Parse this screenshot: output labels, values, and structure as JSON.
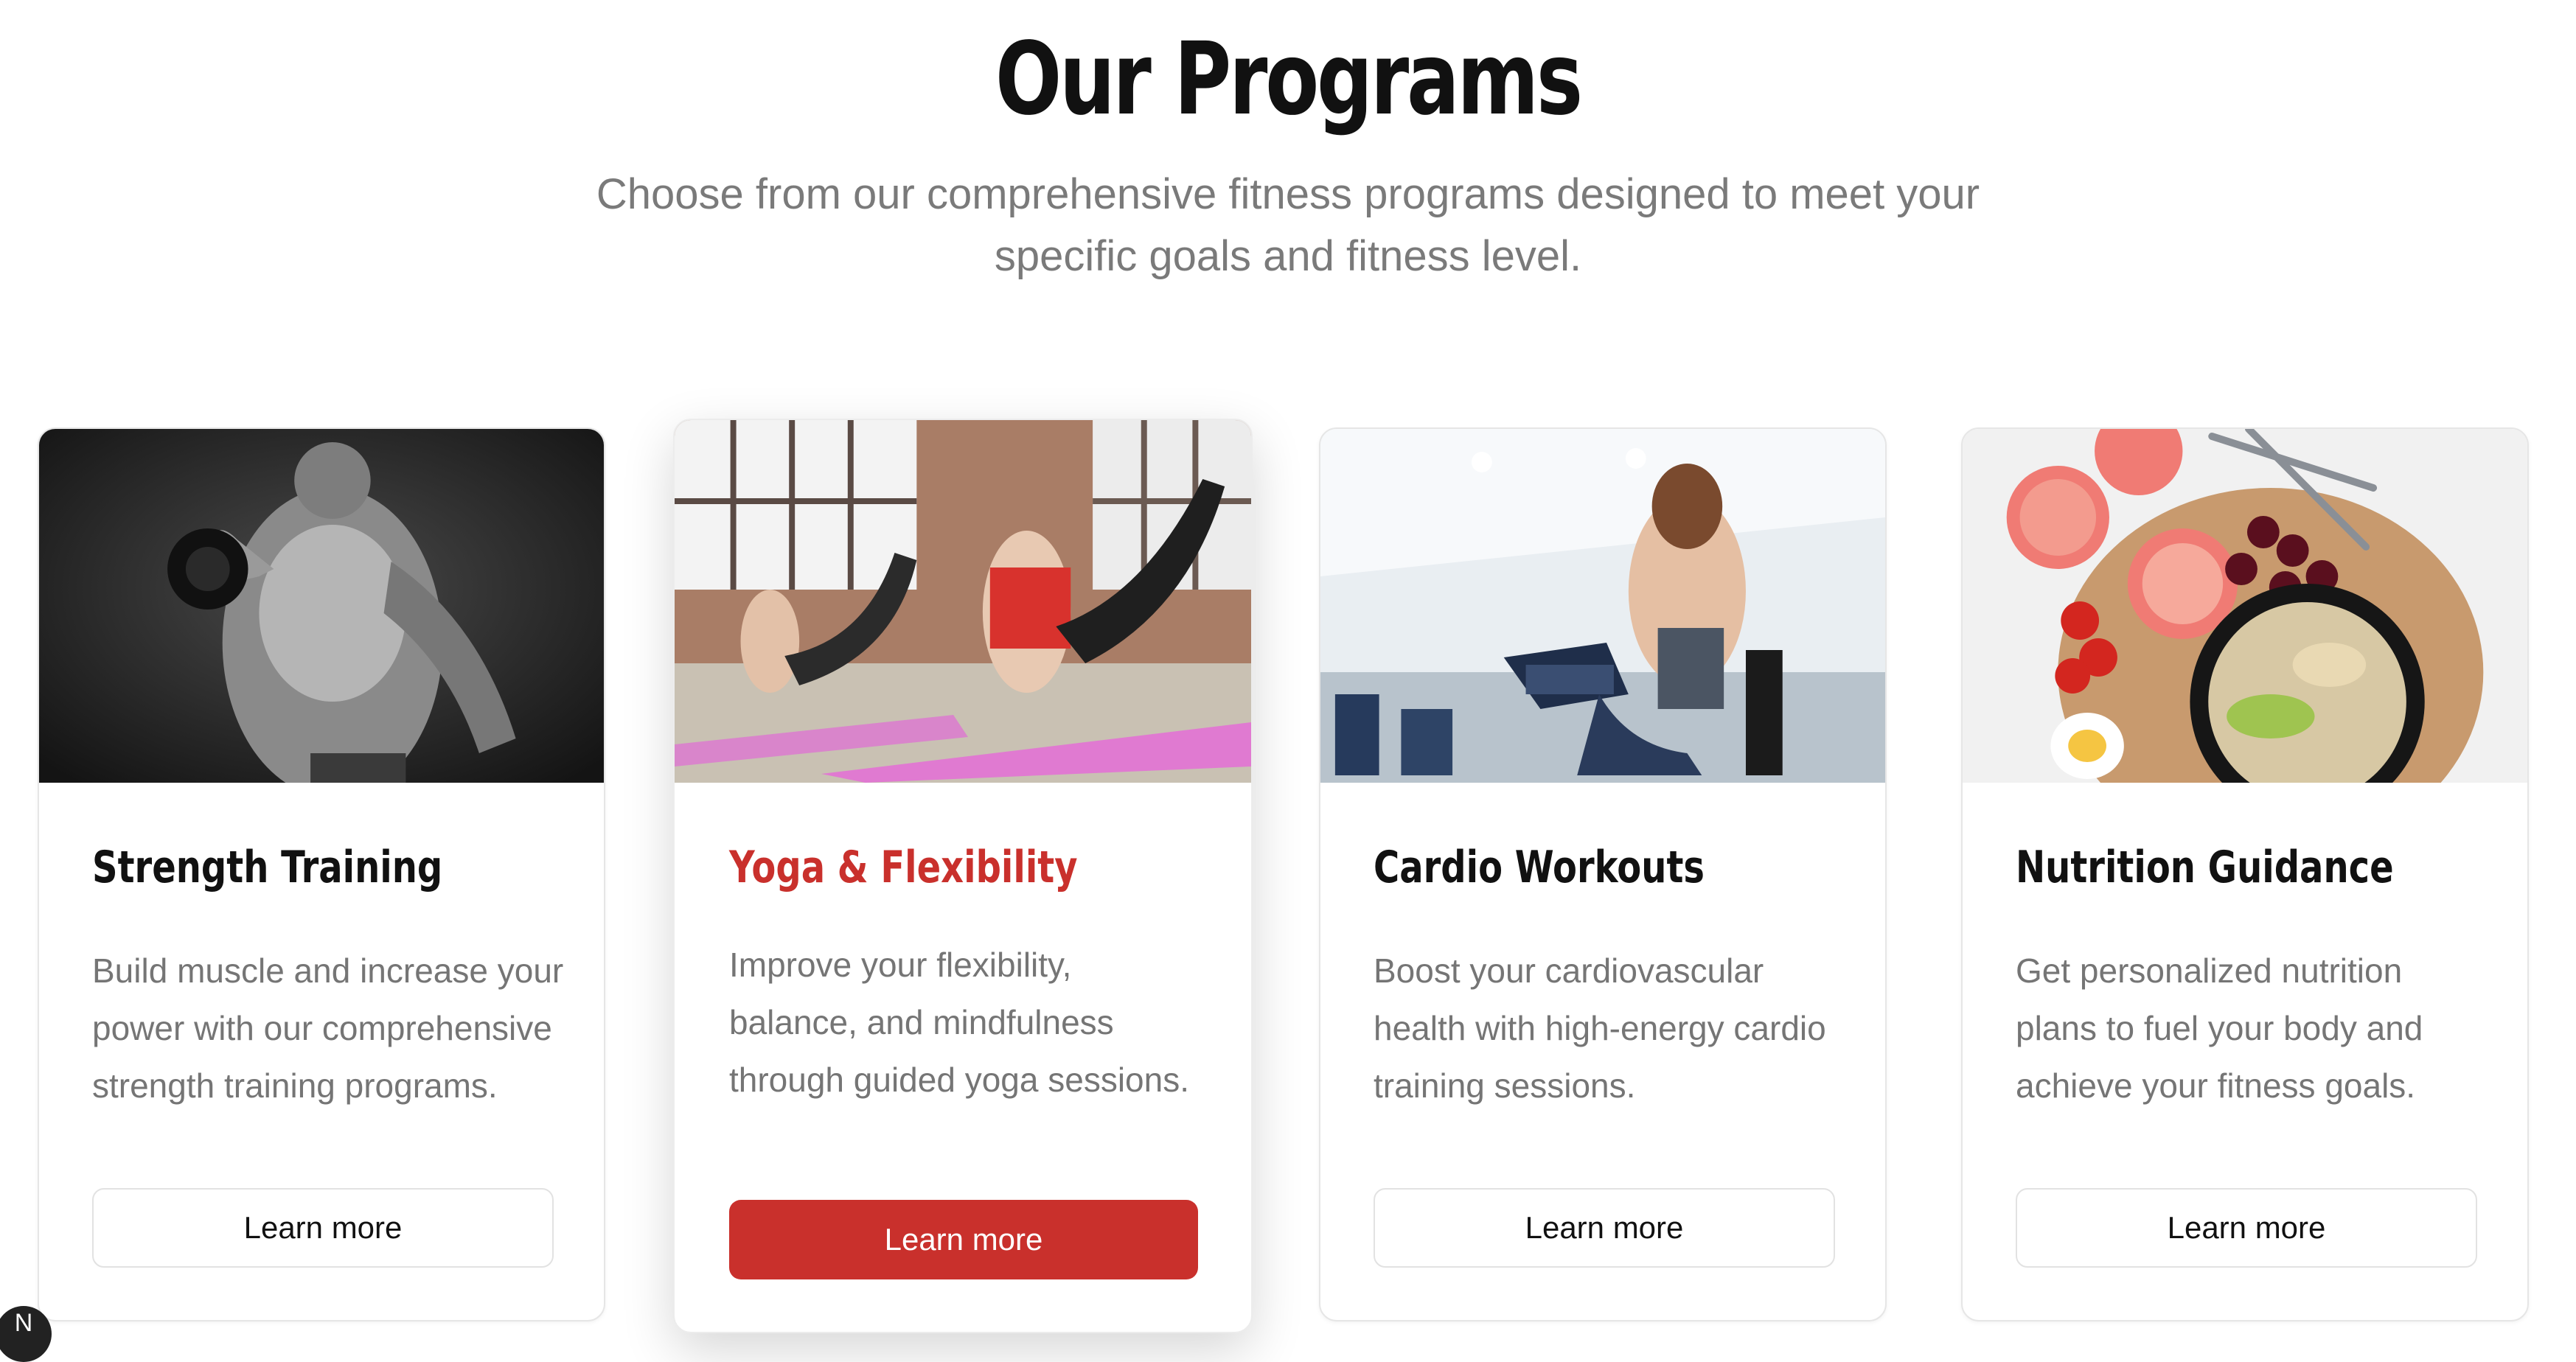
{
  "section": {
    "title": "Our Programs",
    "subtitle": "Choose from our comprehensive fitness programs designed to meet your specific goals and fitness level."
  },
  "programs": [
    {
      "title": "Strength Training",
      "description": "Build muscle and increase your power with our comprehensive strength training programs.",
      "button_label": "Learn more",
      "image": "man-lifting-dumbbell-photo",
      "active": false
    },
    {
      "title": "Yoga & Flexibility",
      "description": "Improve your flexibility, balance, and mindfulness through guided yoga sessions.",
      "button_label": "Learn more",
      "image": "women-yoga-class-photo",
      "active": true
    },
    {
      "title": "Cardio Workouts",
      "description": "Boost your cardiovascular health with high-energy cardio training sessions.",
      "button_label": "Learn more",
      "image": "woman-cardio-machine-photo",
      "active": false
    },
    {
      "title": "Nutrition Guidance",
      "description": "Get personalized nutrition plans to fuel your body and achieve your fitness goals.",
      "button_label": "Learn more",
      "image": "healthy-food-bowl-photo",
      "active": false
    }
  ],
  "dev_badge": {
    "label": "N"
  },
  "colors": {
    "accent": "#c9302c",
    "heading": "#111111",
    "body_text": "#757575",
    "card_border": "#e6e6e6"
  }
}
